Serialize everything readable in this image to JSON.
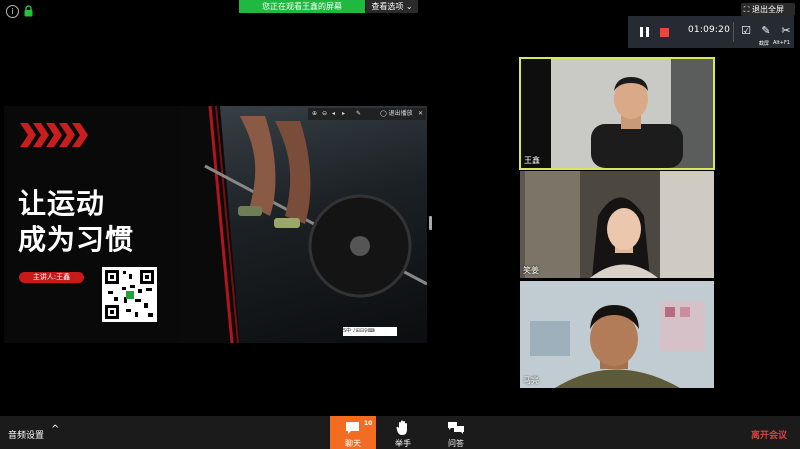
{
  "top": {
    "info_glyph": "i",
    "lock_icon": "lock-icon",
    "share_banner": "您正在观看王鑫的屏幕",
    "view_options": "查看选项 ⌄",
    "exit_fullscreen": "退出全屏"
  },
  "recording": {
    "time": "01:09:20",
    "pause_icon": "pause-icon",
    "stop_icon": "stop-icon",
    "screenshot_label": "截屏",
    "shortcut_label": "Alt+F1"
  },
  "slide": {
    "headline_line1": "让运动",
    "headline_line2": "成为习惯",
    "presenter": "主讲人:王鑫",
    "toolbar_exit": "◯ 退出播放",
    "ime_text": "S中ᐧ♪⊞⊟♀⌨"
  },
  "participants": [
    {
      "name": "王鑫",
      "active_speaker": true
    },
    {
      "name": "笑姜",
      "active_speaker": false
    },
    {
      "name": "马亮",
      "active_speaker": false
    }
  ],
  "bottom": {
    "audio_settings": "音频设置",
    "caret": "^",
    "chat_label": "聊天",
    "chat_count": "10",
    "raise_hand_label": "举手",
    "qa_label": "问答",
    "leave_label": "离开会议"
  },
  "colors": {
    "banner_green": "#1fb840",
    "chat_orange": "#f26d21",
    "speaker_border": "#d8e85a",
    "leave_red": "#e0403a"
  }
}
